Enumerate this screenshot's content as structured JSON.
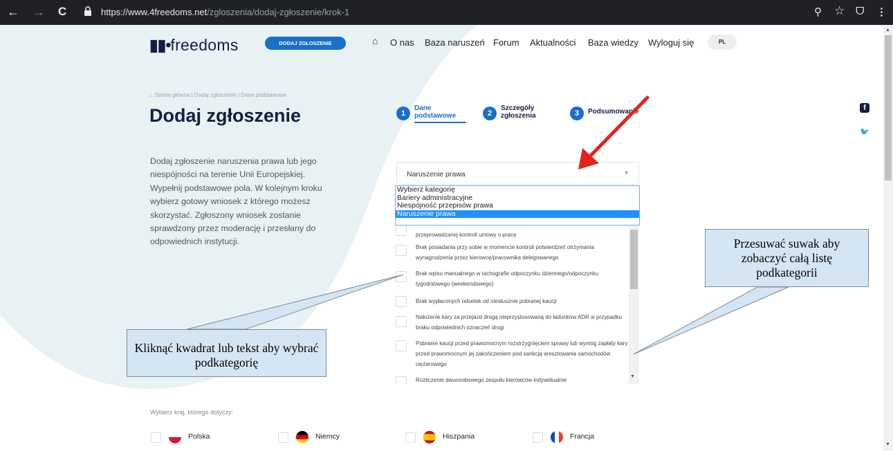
{
  "browser": {
    "url_host": "https://www.4freedoms.net",
    "url_path": "/zgloszenia/dodaj-zgłoszenie/krok-1",
    "back_glyph": "←",
    "forward_glyph": "→",
    "reload_glyph": "C",
    "zoom_glyph": "⚲",
    "star_glyph": "☆",
    "ext_glyph": "ᗜ",
    "menu_glyph": "⋮"
  },
  "header": {
    "logo_mark": "▮▮•",
    "logo_text": "freedoms",
    "add_button": "DODAJ ZGŁOSZENIE",
    "home_glyph": "⌂",
    "nav": [
      "O nas",
      "Baza naruszeń",
      "Forum",
      "Aktualności",
      "Baza wiedzy",
      "Wyloguj się"
    ],
    "lang": "PL"
  },
  "breadcrumb": {
    "home_glyph": "⌂",
    "items": [
      "Strona główna",
      "Dodaj zgłoszenie",
      "Dane podstawowe"
    ],
    "separator": "|"
  },
  "title": "Dodaj zgłoszenie",
  "steps": [
    {
      "num": "1",
      "line1": "Dane",
      "line2": "podstawowe"
    },
    {
      "num": "2",
      "line1": "Szczegóły",
      "line2": "zgłoszenia"
    },
    {
      "num": "3",
      "line1": "Podsumowanie",
      "line2": ""
    }
  ],
  "intro": "Dodaj zgłoszenie naruszenia prawa lub jego niespójności na terenie Unii Europejskiej. Wypełnij podstawowe pola. W kolejnym kroku wybierz gotowy wniosek z którego możesz skorzystać. Zgłoszony wniosek zostanie sprawdzony przez moderację i przesłany do odpowiednich instytucji.",
  "social": {
    "facebook": "f",
    "twitter": "🐦"
  },
  "category_select": {
    "value": "Naruszenie prawa",
    "caret": "▼",
    "options": [
      "Wybierz kategorię",
      "Bariery administracyjne",
      "Niespójność przepisów prawa",
      "Naruszenie prawa"
    ],
    "selected_index": 3
  },
  "subcategories": [
    "przeprowadzanej kontroli umowy o pracę",
    "Brak posiadania przy sobie w momencie kontroli potwierdzeń otrzymania wynagrodzenia przez kierowcę/pracownika delegowanego",
    "Brak wpisu manualnego w tachografie odpoczynku dziennego/odpoczynku tygodniowego (weekendowego)",
    "Brak wypłaconych odsetek od niesłusznie pobranej kaucji",
    "Nałożenie kary za przejazd drogą nieprzystosowaną do ładunków ADR w przypadku braku odpowiednich oznaczeń drogi",
    "Pobranie kaucji przed prawomocnym rozstrzygnięciem sprawy lub wymóg zapłaty kary przed prawomocnym jej zakończeniem pod sankcją aresztowania samochodów ciężarowego",
    "Rozliczenie dwuosobowego zespołu kierowców indywidualnie"
  ],
  "countries": {
    "label": "Wybierz kraj, którego dotyczy:",
    "items": [
      "Polska",
      "Niemcy",
      "Hiszpania",
      "Francja"
    ]
  },
  "callouts": {
    "left": "Kliknąć kwadrat lub tekst aby wybrać podkategorię",
    "right": "Przesuwać suwak aby zobaczyć całą listę podkategorii"
  },
  "colors": {
    "brand_blue": "#1a6fc9",
    "navy": "#151d41",
    "bg_shape": "#e8f1f4",
    "arrow_red": "#e3241b",
    "callout_fill": "#d4e6f3"
  }
}
